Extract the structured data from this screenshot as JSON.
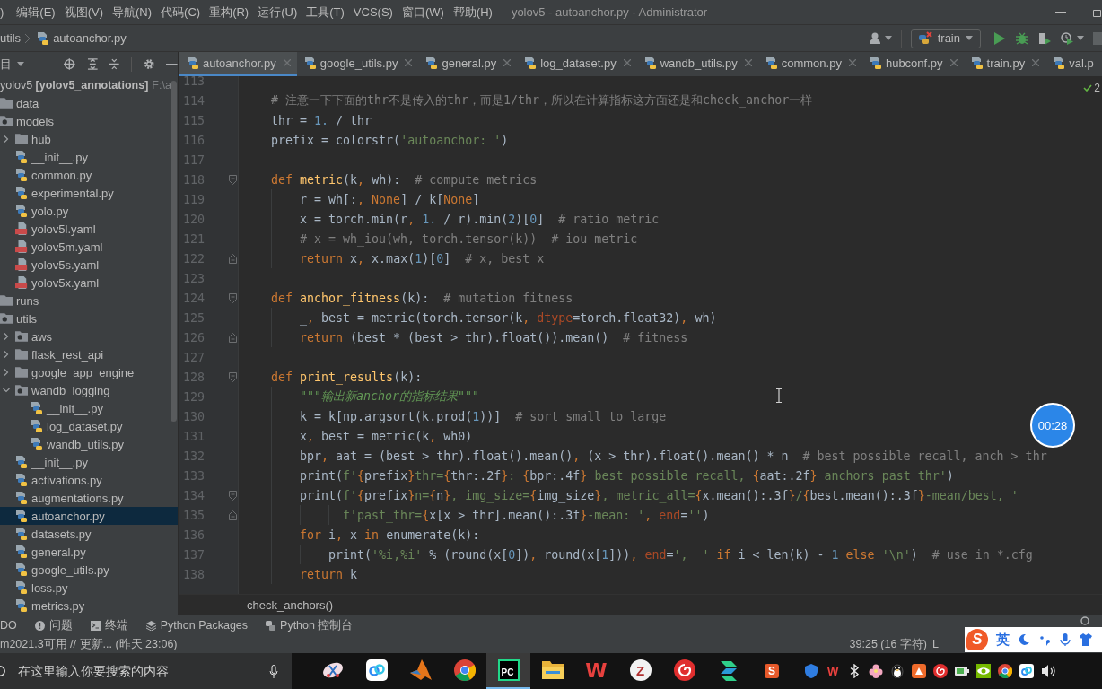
{
  "title_bar": {
    "menu": [
      ")",
      "编辑(E)",
      "视图(V)",
      "导航(N)",
      "代码(C)",
      "重构(R)",
      "运行(U)",
      "工具(T)",
      "VCS(S)",
      "窗口(W)",
      "帮助(H)"
    ],
    "title": "yolov5 - autoanchor.py - Administrator"
  },
  "nav_bar": {
    "breadcrumbs": [
      {
        "label": "utils",
        "kind": "folder"
      },
      {
        "label": "autoanchor.py",
        "kind": "python"
      }
    ],
    "run_config": "train"
  },
  "project_panel": {
    "header": "目",
    "tree": [
      {
        "label": "yolov5 **[yolov5_annotations]**",
        "path": "F:\\a",
        "selected": false,
        "children": [
          {
            "label": "data",
            "kind": "folder",
            "selected": false
          },
          {
            "label": "models",
            "kind": "package",
            "selected": false,
            "children": [
              {
                "label": "hub",
                "kind": "folder",
                "expanded": false,
                "selected": false
              },
              {
                "label": "__init__.py",
                "kind": "python",
                "selected": false
              },
              {
                "label": "common.py",
                "kind": "python",
                "selected": false
              },
              {
                "label": "experimental.py",
                "kind": "python",
                "selected": false
              },
              {
                "label": "yolo.py",
                "kind": "python",
                "selected": false
              },
              {
                "label": "yolov5l.yaml",
                "kind": "yaml",
                "selected": false
              },
              {
                "label": "yolov5m.yaml",
                "kind": "yaml",
                "selected": false
              },
              {
                "label": "yolov5s.yaml",
                "kind": "yaml",
                "selected": false
              },
              {
                "label": "yolov5x.yaml",
                "kind": "yaml",
                "selected": false
              }
            ]
          },
          {
            "label": "runs",
            "kind": "folder",
            "selected": false
          },
          {
            "label": "utils",
            "kind": "package",
            "selected": false,
            "children": [
              {
                "label": "aws",
                "kind": "package",
                "expanded": false,
                "selected": false
              },
              {
                "label": "flask_rest_api",
                "kind": "folder",
                "expanded": false,
                "selected": false
              },
              {
                "label": "google_app_engine",
                "kind": "folder",
                "expanded": false,
                "selected": false
              },
              {
                "label": "wandb_logging",
                "kind": "package",
                "expanded": true,
                "selected": false,
                "children": [
                  {
                    "label": "__init__.py",
                    "kind": "python",
                    "selected": false
                  },
                  {
                    "label": "log_dataset.py",
                    "kind": "python",
                    "selected": false
                  },
                  {
                    "label": "wandb_utils.py",
                    "kind": "python",
                    "selected": false
                  }
                ]
              },
              {
                "label": "__init__.py",
                "kind": "python",
                "selected": false
              },
              {
                "label": "activations.py",
                "kind": "python",
                "selected": false
              },
              {
                "label": "augmentations.py",
                "kind": "python",
                "selected": false
              },
              {
                "label": "autoanchor.py",
                "kind": "python",
                "selected": true
              },
              {
                "label": "datasets.py",
                "kind": "python",
                "selected": false
              },
              {
                "label": "general.py",
                "kind": "python",
                "selected": false
              },
              {
                "label": "google_utils.py",
                "kind": "python",
                "selected": false
              },
              {
                "label": "loss.py",
                "kind": "python",
                "selected": false
              },
              {
                "label": "metrics.py",
                "kind": "python",
                "selected": false
              }
            ]
          }
        ]
      }
    ]
  },
  "tabs": [
    {
      "label": "autoanchor.py",
      "selected": true
    },
    {
      "label": "google_utils.py",
      "selected": false
    },
    {
      "label": "general.py",
      "selected": false
    },
    {
      "label": "log_dataset.py",
      "selected": false
    },
    {
      "label": "wandb_utils.py",
      "selected": false
    },
    {
      "label": "common.py",
      "selected": false
    },
    {
      "label": "hubconf.py",
      "selected": false
    },
    {
      "label": "train.py",
      "selected": false
    },
    {
      "label": "val.p",
      "selected": false
    }
  ],
  "editor": {
    "inspections": "2",
    "lines": [
      {
        "number": "113"
      },
      {
        "number": "114",
        "tokens": [
          {
            "kind": "comment",
            "text": "    # 注意一下下面的thr不是传入的thr，而是1/thr，所以在计算指标这方面还是和check_anchor一样"
          }
        ]
      },
      {
        "number": "115",
        "tokens": [
          {
            "kind": "plain",
            "text": "    thr = "
          },
          {
            "kind": "number",
            "text": "1."
          },
          {
            "kind": "plain",
            "text": " / thr"
          }
        ]
      },
      {
        "number": "116",
        "tokens": [
          {
            "kind": "plain",
            "text": "    prefix = colorstr("
          },
          {
            "kind": "string",
            "text": "'autoanchor: '"
          },
          {
            "kind": "plain",
            "text": ")"
          }
        ]
      },
      {
        "number": "117"
      },
      {
        "number": "118",
        "fold": {
          "kind": "start"
        },
        "tokens": [
          {
            "kind": "keyword",
            "text": "    def "
          },
          {
            "kind": "function",
            "text": "metric"
          },
          {
            "kind": "plain",
            "text": "(k"
          },
          {
            "kind": "keyword",
            "text": ", "
          },
          {
            "kind": "plain",
            "text": "wh):  "
          },
          {
            "kind": "comment",
            "text": "# compute metrics"
          }
        ]
      },
      {
        "number": "119",
        "tokens": [
          {
            "kind": "plain",
            "text": "        r = wh[:"
          },
          {
            "kind": "keyword",
            "text": ", None"
          },
          {
            "kind": "plain",
            "text": "] / k["
          },
          {
            "kind": "keyword",
            "text": "None"
          },
          {
            "kind": "plain",
            "text": "]"
          }
        ]
      },
      {
        "number": "120",
        "tokens": [
          {
            "kind": "plain",
            "text": "        x = torch.min(r"
          },
          {
            "kind": "keyword",
            "text": ", "
          },
          {
            "kind": "number",
            "text": "1."
          },
          {
            "kind": "plain",
            "text": " / r).min("
          },
          {
            "kind": "number",
            "text": "2"
          },
          {
            "kind": "plain",
            "text": ")["
          },
          {
            "kind": "number",
            "text": "0"
          },
          {
            "kind": "plain",
            "text": "]  "
          },
          {
            "kind": "comment",
            "text": "# ratio metric"
          }
        ]
      },
      {
        "number": "121",
        "tokens": [
          {
            "kind": "comment",
            "text": "        # x = wh_iou(wh, torch.tensor(k))  # iou metric"
          }
        ]
      },
      {
        "number": "122",
        "fold": {
          "kind": "end"
        },
        "tokens": [
          {
            "kind": "keyword",
            "text": "        return "
          },
          {
            "kind": "plain",
            "text": "x"
          },
          {
            "kind": "keyword",
            "text": ", "
          },
          {
            "kind": "plain",
            "text": "x.max("
          },
          {
            "kind": "number",
            "text": "1"
          },
          {
            "kind": "plain",
            "text": ")["
          },
          {
            "kind": "number",
            "text": "0"
          },
          {
            "kind": "plain",
            "text": "]  "
          },
          {
            "kind": "comment",
            "text": "# x, best_x"
          }
        ]
      },
      {
        "number": "123"
      },
      {
        "number": "124",
        "fold": {
          "kind": "start"
        },
        "tokens": [
          {
            "kind": "keyword",
            "text": "    def "
          },
          {
            "kind": "function",
            "text": "anchor_fitness"
          },
          {
            "kind": "plain",
            "text": "(k):  "
          },
          {
            "kind": "comment",
            "text": "# mutation fitness"
          }
        ]
      },
      {
        "number": "125",
        "tokens": [
          {
            "kind": "plain",
            "text": "        _"
          },
          {
            "kind": "keyword",
            "text": ", "
          },
          {
            "kind": "plain",
            "text": "best = metric(torch.tensor(k"
          },
          {
            "kind": "keyword",
            "text": ", "
          },
          {
            "kind": "argument",
            "text": "dtype"
          },
          {
            "kind": "plain",
            "text": "=torch.float32)"
          },
          {
            "kind": "keyword",
            "text": ", "
          },
          {
            "kind": "plain",
            "text": "wh)"
          }
        ]
      },
      {
        "number": "126",
        "fold": {
          "kind": "end"
        },
        "tokens": [
          {
            "kind": "keyword",
            "text": "        return "
          },
          {
            "kind": "plain",
            "text": "(best * (best > thr).float()).mean()  "
          },
          {
            "kind": "comment",
            "text": "# fitness"
          }
        ]
      },
      {
        "number": "127"
      },
      {
        "number": "128",
        "fold": {
          "kind": "start"
        },
        "tokens": [
          {
            "kind": "keyword",
            "text": "    def "
          },
          {
            "kind": "function",
            "text": "print_results"
          },
          {
            "kind": "plain",
            "text": "(k):"
          }
        ]
      },
      {
        "number": "129",
        "tokens": [
          {
            "kind": "docstring",
            "text": "        \"\"\"输出新anchor的指标结果\"\"\""
          }
        ]
      },
      {
        "number": "130",
        "tokens": [
          {
            "kind": "plain",
            "text": "        k = k[np.argsort(k.prod("
          },
          {
            "kind": "number",
            "text": "1"
          },
          {
            "kind": "plain",
            "text": "))]  "
          },
          {
            "kind": "comment",
            "text": "# sort small to large"
          }
        ]
      },
      {
        "number": "131",
        "tokens": [
          {
            "kind": "plain",
            "text": "        x"
          },
          {
            "kind": "keyword",
            "text": ", "
          },
          {
            "kind": "plain",
            "text": "best = metric(k"
          },
          {
            "kind": "keyword",
            "text": ", "
          },
          {
            "kind": "plain",
            "text": "wh0)"
          }
        ]
      },
      {
        "number": "132",
        "tokens": [
          {
            "kind": "plain",
            "text": "        bpr"
          },
          {
            "kind": "keyword",
            "text": ", "
          },
          {
            "kind": "plain",
            "text": "aat = (best > thr).float().mean()"
          },
          {
            "kind": "keyword",
            "text": ", "
          },
          {
            "kind": "plain",
            "text": "(x > thr).float().mean() * n  "
          },
          {
            "kind": "comment",
            "text": "# best possible recall, anch > thr"
          }
        ]
      },
      {
        "number": "133",
        "tokens": [
          {
            "kind": "plain",
            "text": "        print("
          },
          {
            "kind": "string",
            "text": "f'"
          },
          {
            "kind": "brace",
            "text": "{"
          },
          {
            "kind": "plain",
            "text": "prefix"
          },
          {
            "kind": "brace",
            "text": "}"
          },
          {
            "kind": "string",
            "text": "thr="
          },
          {
            "kind": "brace",
            "text": "{"
          },
          {
            "kind": "plain",
            "text": "thr:.2f"
          },
          {
            "kind": "brace",
            "text": "}"
          },
          {
            "kind": "string",
            "text": ": "
          },
          {
            "kind": "brace",
            "text": "{"
          },
          {
            "kind": "plain",
            "text": "bpr:.4f"
          },
          {
            "kind": "brace",
            "text": "}"
          },
          {
            "kind": "string",
            "text": " best possible recall, "
          },
          {
            "kind": "brace",
            "text": "{"
          },
          {
            "kind": "plain",
            "text": "aat:.2f"
          },
          {
            "kind": "brace",
            "text": "}"
          },
          {
            "kind": "string",
            "text": " anchors past thr'"
          },
          {
            "kind": "plain",
            "text": ")"
          }
        ]
      },
      {
        "number": "134",
        "fold": {
          "kind": "start"
        },
        "tokens": [
          {
            "kind": "plain",
            "text": "        print("
          },
          {
            "kind": "string",
            "text": "f'"
          },
          {
            "kind": "brace",
            "text": "{"
          },
          {
            "kind": "plain",
            "text": "prefix"
          },
          {
            "kind": "brace",
            "text": "}"
          },
          {
            "kind": "string",
            "text": "n="
          },
          {
            "kind": "brace",
            "text": "{"
          },
          {
            "kind": "plain",
            "text": "n"
          },
          {
            "kind": "brace",
            "text": "}"
          },
          {
            "kind": "string",
            "text": ", img_size="
          },
          {
            "kind": "brace",
            "text": "{"
          },
          {
            "kind": "plain",
            "text": "img_size"
          },
          {
            "kind": "brace",
            "text": "}"
          },
          {
            "kind": "string",
            "text": ", metric_all="
          },
          {
            "kind": "brace",
            "text": "{"
          },
          {
            "kind": "plain",
            "text": "x.mean():.3f"
          },
          {
            "kind": "brace",
            "text": "}"
          },
          {
            "kind": "string",
            "text": "/"
          },
          {
            "kind": "brace",
            "text": "{"
          },
          {
            "kind": "plain",
            "text": "best.mean():.3f"
          },
          {
            "kind": "brace",
            "text": "}"
          },
          {
            "kind": "string",
            "text": "-mean/best, '"
          }
        ]
      },
      {
        "number": "135",
        "fold": {
          "kind": "end"
        },
        "tokens": [
          {
            "kind": "string",
            "text": "              f'past_thr="
          },
          {
            "kind": "brace",
            "text": "{"
          },
          {
            "kind": "plain",
            "text": "x[x > thr].mean():.3f"
          },
          {
            "kind": "brace",
            "text": "}"
          },
          {
            "kind": "string",
            "text": "-mean: '"
          },
          {
            "kind": "keyword",
            "text": ", "
          },
          {
            "kind": "argument",
            "text": "end"
          },
          {
            "kind": "plain",
            "text": "="
          },
          {
            "kind": "string",
            "text": "''"
          },
          {
            "kind": "plain",
            "text": ")"
          }
        ]
      },
      {
        "number": "136",
        "tokens": [
          {
            "kind": "keyword",
            "text": "        for "
          },
          {
            "kind": "plain",
            "text": "i"
          },
          {
            "kind": "keyword",
            "text": ", "
          },
          {
            "kind": "plain",
            "text": "x "
          },
          {
            "kind": "keyword",
            "text": "in "
          },
          {
            "kind": "plain",
            "text": "enumerate(k):"
          }
        ]
      },
      {
        "number": "137",
        "tokens": [
          {
            "kind": "plain",
            "text": "            print("
          },
          {
            "kind": "string",
            "text": "'%i,%i'"
          },
          {
            "kind": "plain",
            "text": " % (round(x["
          },
          {
            "kind": "number",
            "text": "0"
          },
          {
            "kind": "plain",
            "text": "])"
          },
          {
            "kind": "keyword",
            "text": ", "
          },
          {
            "kind": "plain",
            "text": "round(x["
          },
          {
            "kind": "number",
            "text": "1"
          },
          {
            "kind": "plain",
            "text": "]))"
          },
          {
            "kind": "keyword",
            "text": ", "
          },
          {
            "kind": "argument",
            "text": "end"
          },
          {
            "kind": "plain",
            "text": "="
          },
          {
            "kind": "string",
            "text": "',  '"
          },
          {
            "kind": "keyword",
            "text": " if "
          },
          {
            "kind": "plain",
            "text": "i < len(k) - "
          },
          {
            "kind": "number",
            "text": "1"
          },
          {
            "kind": "keyword",
            "text": " else "
          },
          {
            "kind": "string",
            "text": "'\\n'"
          },
          {
            "kind": "plain",
            "text": ")  "
          },
          {
            "kind": "comment",
            "text": "# use in *.cfg"
          }
        ]
      },
      {
        "number": "138",
        "tokens": [
          {
            "kind": "keyword",
            "text": "        return "
          },
          {
            "kind": "plain",
            "text": "k"
          }
        ]
      }
    ],
    "breadcrumb": "check_anchors()"
  },
  "tool_windows": [
    "DO",
    "问题",
    "终端",
    "Python Packages",
    "Python 控制台"
  ],
  "status_bar": {
    "message": "m2021.3可用 // 更新... (昨天 23:06)",
    "position": "39:25 (16 字符)",
    "line_separator": "L"
  },
  "recording_timer": "00:28",
  "ime_bar": {
    "logo": "S",
    "mode": "英"
  },
  "taskbar": {
    "search": {
      "placeholder": "在这里输入你要搜索的内容"
    },
    "apps": [
      {
        "selected": false
      },
      {
        "selected": false
      },
      {
        "selected": false
      },
      {
        "selected": false
      },
      {
        "selected": true,
        "logo_text": "PC"
      },
      {
        "selected": false
      },
      {
        "selected": false,
        "logo_text": "W"
      },
      {
        "selected": false,
        "logo_text": "Z"
      },
      {
        "selected": false
      },
      {
        "selected": false
      }
    ],
    "tray": {
      "ime_logo": "S",
      "office_logo": "W"
    }
  }
}
